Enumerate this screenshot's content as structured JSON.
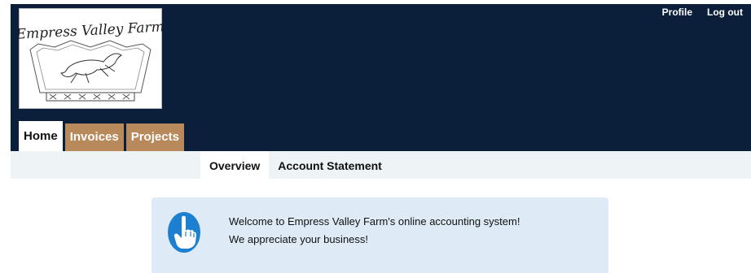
{
  "header": {
    "logo": {
      "text": "Empress Valley Farm",
      "icon": "horse-jumping-logo"
    },
    "links": {
      "profile": "Profile",
      "logout": "Log out"
    },
    "tabs": [
      "Home",
      "Invoices",
      "Projects"
    ],
    "active_tab": "Home"
  },
  "subnav": {
    "items": [
      "Overview",
      "Account Statement"
    ],
    "active": "Overview"
  },
  "welcome": {
    "icon": "pointing-finger-icon",
    "line1": "Welcome to Empress Valley Farm's online accounting system!",
    "line2": "We appreciate your business!"
  },
  "colors": {
    "header_bg": "#0b1e3a",
    "tab_inactive": "#b8895a",
    "subnav_bg": "#eef4f5",
    "welcome_bg": "#deeaf6",
    "icon_blue": "#1d7fcf"
  }
}
